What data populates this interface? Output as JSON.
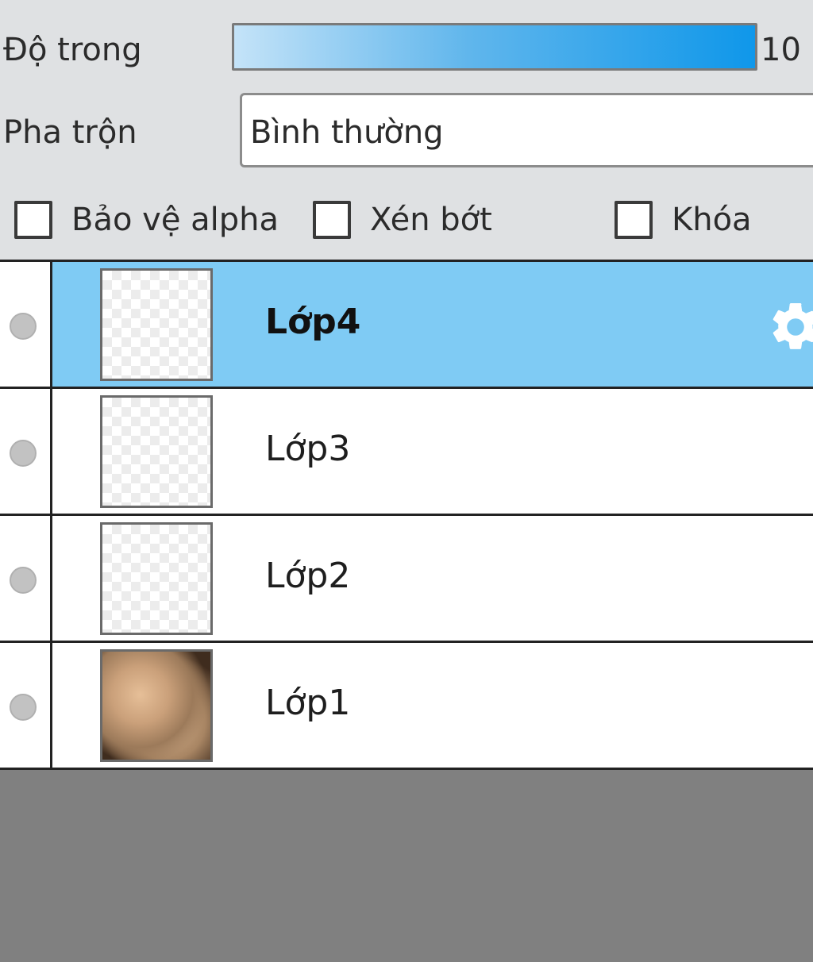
{
  "properties": {
    "opacity_label": "Độ trong",
    "opacity_value_text": "10",
    "opacity_percent": 100,
    "blend_label": "Pha trộn",
    "blend_value": "Bình thường",
    "checkboxes": {
      "protect_alpha": {
        "label": "Bảo vệ alpha",
        "checked": false
      },
      "clip": {
        "label": "Xén bớt",
        "checked": false
      },
      "lock": {
        "label": "Khóa",
        "checked": false
      }
    }
  },
  "layers": [
    {
      "name": "Lớp4",
      "selected": true,
      "visible_icon": "visibility-dot-icon",
      "thumbnail": "transparent"
    },
    {
      "name": "Lớp3",
      "selected": false,
      "visible_icon": "visibility-dot-icon",
      "thumbnail": "transparent"
    },
    {
      "name": "Lớp2",
      "selected": false,
      "visible_icon": "visibility-dot-icon",
      "thumbnail": "transparent"
    },
    {
      "name": "Lớp1",
      "selected": false,
      "visible_icon": "visibility-dot-icon",
      "thumbnail": "photo"
    }
  ],
  "colors": {
    "selected_row": "#7fcbf4",
    "panel_bg": "#dfe1e3",
    "empty_area": "#808080",
    "slider_fill": "#0f97ea"
  },
  "icons": {
    "layer_settings": "gear-icon"
  }
}
